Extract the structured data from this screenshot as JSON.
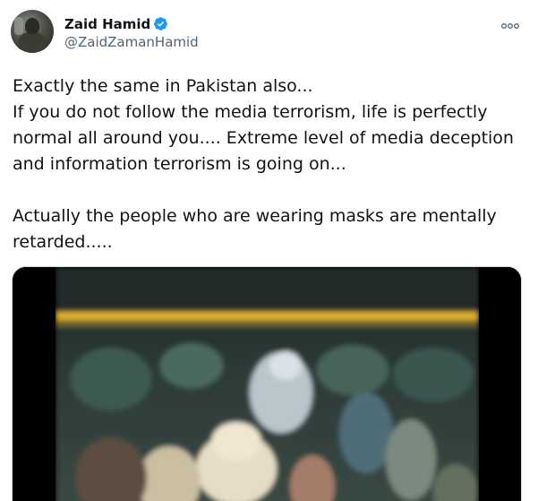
{
  "tweet": {
    "author": {
      "display_name": "Zaid Hamid",
      "handle": "@ZaidZamanHamid",
      "verified": true
    },
    "more_icon": "more-horizontal-icon",
    "text": {
      "line1": "Exactly the same in Pakistan also...",
      "line2": "If you do not follow the media terrorism, life is perfectly normal all around you.... Extreme level of media deception and information terrorism is going on...",
      "line3": "Actually the people who are wearing masks are mentally retarded....."
    },
    "media": {
      "type": "video"
    }
  },
  "colors": {
    "text": "#0f1419",
    "secondary": "#536471",
    "verified_badge": "#1d9bf0",
    "border": "#cfd9de"
  }
}
